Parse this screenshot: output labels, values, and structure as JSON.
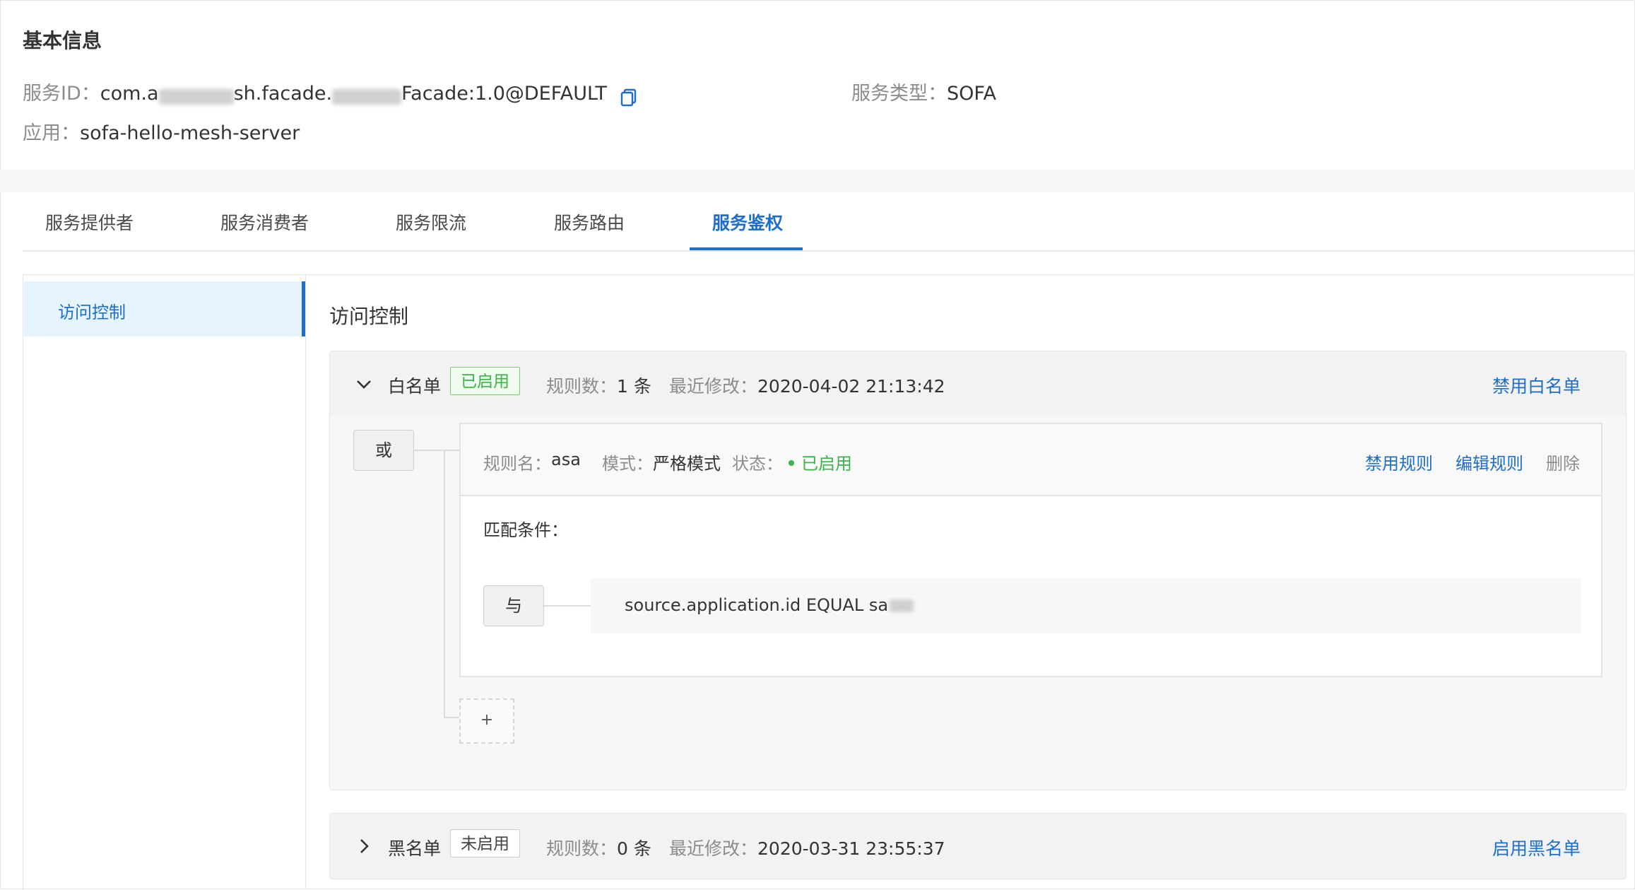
{
  "basic_info": {
    "title": "基本信息",
    "service_id_label": "服务ID：",
    "service_id_prefix": "com.a",
    "service_id_middle": "sh.facade.",
    "service_id_suffix": "Facade:1.0@DEFAULT",
    "service_type_label": "服务类型：",
    "service_type_value": "SOFA",
    "app_label": "应用：",
    "app_value": "sofa-hello-mesh-server"
  },
  "tabs": [
    {
      "label": "服务提供者",
      "active": false
    },
    {
      "label": "服务消费者",
      "active": false
    },
    {
      "label": "服务限流",
      "active": false
    },
    {
      "label": "服务路由",
      "active": false
    },
    {
      "label": "服务鉴权",
      "active": true
    }
  ],
  "sidebar": {
    "items": [
      {
        "label": "访问控制",
        "active": true
      }
    ]
  },
  "panel": {
    "title": "访问控制",
    "whitelist": {
      "name": "白名单",
      "status": "已启用",
      "rule_count_label": "规则数：",
      "rule_count_value": "1 条",
      "modified_label": "最近修改：",
      "modified_value": "2020-04-02 21:13:42",
      "action": "禁用白名单",
      "logic_operator": "或",
      "rule": {
        "name_label": "规则名：",
        "name_value": "asa",
        "mode_label": "模式：",
        "mode_value": "严格模式",
        "state_label": "状态：",
        "state_value": "已启用",
        "actions": [
          "禁用规则",
          "编辑规则",
          "删除"
        ],
        "condition_label": "匹配条件：",
        "condition_operator": "与",
        "condition_text": "source.application.id  EQUAL  sa"
      },
      "add_label": "+"
    },
    "blacklist": {
      "name": "黑名单",
      "status": "未启用",
      "rule_count_label": "规则数：",
      "rule_count_value": "0 条",
      "modified_label": "最近修改：",
      "modified_value": "2020-03-31 23:55:37",
      "action": "启用黑名单"
    }
  },
  "colors": {
    "accent": "#1f6ec9",
    "success": "#39b54a",
    "muted": "#8c8c8c"
  }
}
